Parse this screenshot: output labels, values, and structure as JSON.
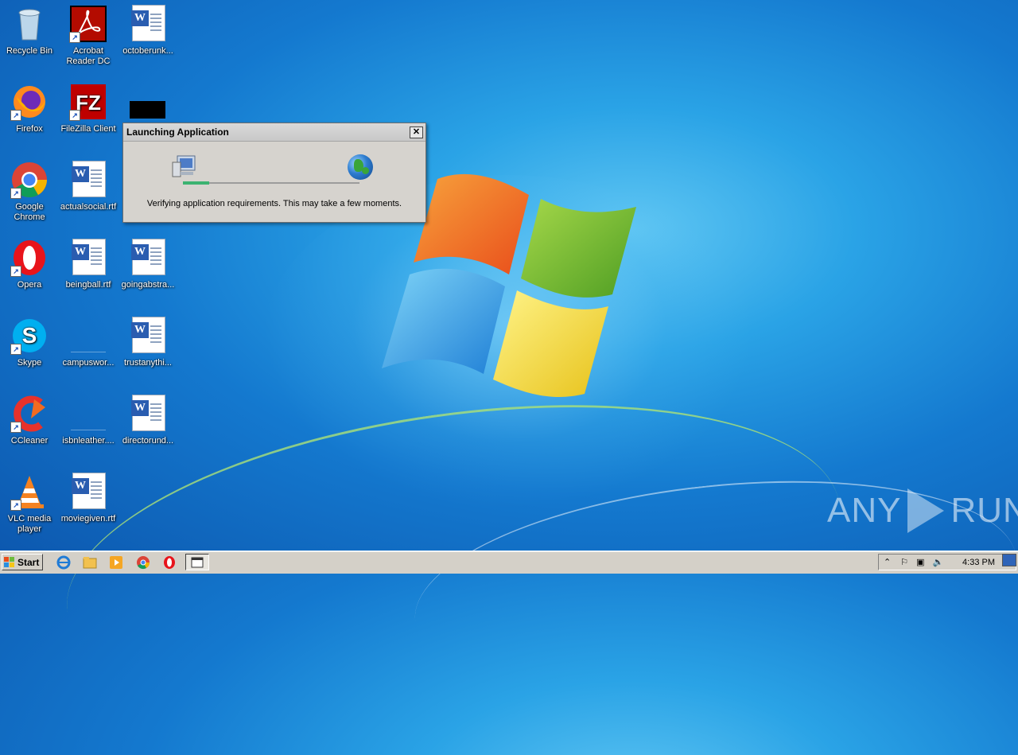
{
  "desktop": {
    "icons": [
      {
        "label": "Recycle Bin"
      },
      {
        "label": "Acrobat Reader DC"
      },
      {
        "label": "octoberunk..."
      },
      {
        "label": "Firefox"
      },
      {
        "label": "FileZilla Client"
      },
      {
        "label": "Google Chrome"
      },
      {
        "label": "actualsocial.rtf"
      },
      {
        "label": "Opera"
      },
      {
        "label": "beingball.rtf"
      },
      {
        "label": "goingabstra..."
      },
      {
        "label": "Skype"
      },
      {
        "label": "campuswor..."
      },
      {
        "label": "trustanythi..."
      },
      {
        "label": "CCleaner"
      },
      {
        "label": "isbnleather...."
      },
      {
        "label": "directorund..."
      },
      {
        "label": "VLC media player"
      },
      {
        "label": "moviegiven.rtf"
      }
    ]
  },
  "dialog": {
    "title": "Launching Application",
    "close_label": "✕",
    "status": "Verifying application requirements. This may take a few moments.",
    "progress": 0.15
  },
  "watermark": {
    "left": "ANY",
    "right": "RUN"
  },
  "taskbar": {
    "start_label": "Start",
    "clock": "4:33 PM"
  },
  "colors": {
    "accent": "#2a5db0",
    "taskbar": "#d4d0c8",
    "desktop": "#1479cf"
  }
}
